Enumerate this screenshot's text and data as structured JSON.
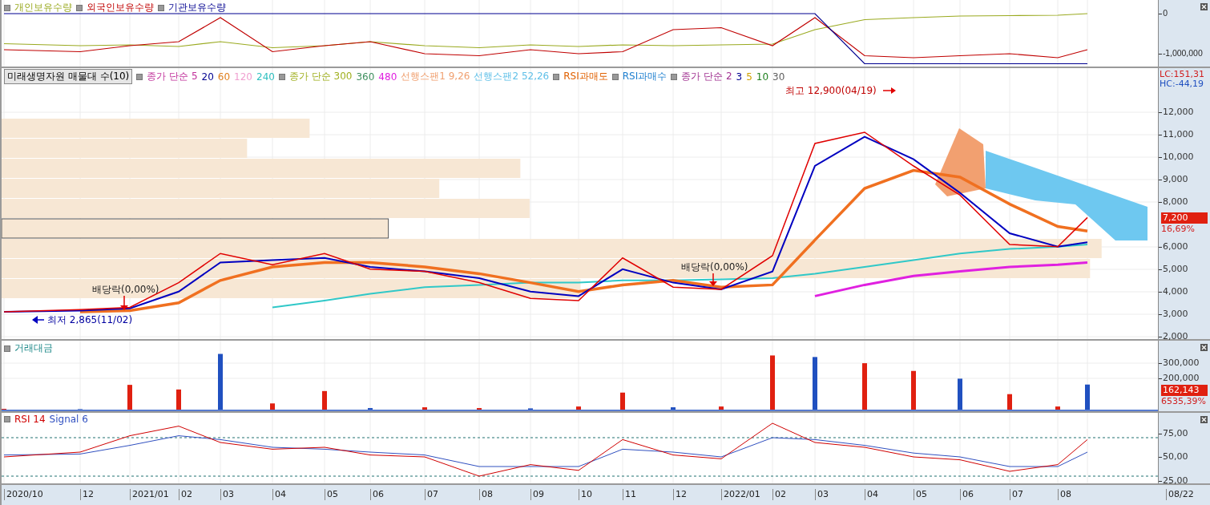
{
  "holdings_panel": {
    "legend": [
      "개인보유수량",
      "외국인보유수량",
      "기관보유수량"
    ],
    "axis_labels": [
      "0",
      "-1,000,000"
    ]
  },
  "price_panel": {
    "title": "미래생명자원 매물대 수(10)",
    "legend": [
      {
        "items": [
          {
            "text": "종가 단순 5",
            "color": "#c0309a"
          },
          {
            "text": "20",
            "color": "#000090"
          },
          {
            "text": "60",
            "color": "#e08020"
          },
          {
            "text": "120",
            "color": "#f0a0d0"
          },
          {
            "text": "240",
            "color": "#30c0c0"
          }
        ]
      },
      {
        "items": [
          {
            "text": "종가 단순 300",
            "color": "#a0b020"
          },
          {
            "text": "360",
            "color": "#409060"
          },
          {
            "text": "480",
            "color": "#e020e0"
          },
          {
            "text": "선행스팬1 9,26",
            "color": "#f0a070"
          },
          {
            "text": "선행스팬2 52,26",
            "color": "#60c0e8"
          }
        ]
      },
      {
        "items": [
          {
            "text": "RSI과매도",
            "color": "#e06000"
          }
        ]
      },
      {
        "items": [
          {
            "text": "RSI과매수",
            "color": "#2080d0"
          }
        ]
      },
      {
        "items": [
          {
            "text": "종가 단순 2",
            "color": "#a03090"
          },
          {
            "text": "3",
            "color": "#000090"
          },
          {
            "text": "5",
            "color": "#d0a000"
          },
          {
            "text": "10",
            "color": "#208020"
          },
          {
            "text": "30",
            "color": "#606060"
          }
        ]
      }
    ],
    "volume_profile": [
      {
        "level": 0.266,
        "selected": false
      },
      {
        "level": 0.212,
        "selected": false
      },
      {
        "level": 0.448,
        "selected": false
      },
      {
        "level": 0.378,
        "selected": false
      },
      {
        "level": 0.456,
        "selected": false
      },
      {
        "level": 0.334,
        "selected": true
      },
      {
        "level": 0.95,
        "selected": false
      },
      {
        "level": 0.94,
        "selected": false
      },
      {
        "level": 0.5,
        "selected": false
      }
    ],
    "high_label": "최고 12,900(04/19)",
    "low_label": "최저 2,865(11/02)",
    "ex_dividend_labels": [
      "배당락(0,00%)",
      "배당락(0,00%)"
    ],
    "lc": "LC:151,31",
    "hc": "HC:-44,19",
    "axis_labels": [
      "12,000",
      "11,000",
      "10,000",
      "9,000",
      "8,000",
      "6,000",
      "5,000",
      "4,000",
      "3,000",
      "2,000"
    ],
    "last_price": "7,200",
    "change": "16,69%"
  },
  "volume_panel": {
    "legend": "거래대금",
    "axis_labels": [
      "300,000",
      "200,000"
    ],
    "last_value": "162,143",
    "change": "6535,39%"
  },
  "rsi_panel": {
    "legend": [
      {
        "text": "RSI 14",
        "color": "#d00000"
      },
      {
        "text": "Signal 6",
        "color": "#3050c0"
      }
    ],
    "axis_labels": [
      "75,00",
      "50,00",
      "25,00"
    ]
  },
  "x_axis": {
    "labels": [
      "2020/10",
      "12",
      "2021/01",
      "02",
      "03",
      "04",
      "05",
      "06",
      "07",
      "08",
      "09",
      "10",
      "11",
      "12",
      "2022/01",
      "02",
      "03",
      "04",
      "05",
      "06",
      "07",
      "08",
      "08/22"
    ]
  }
}
